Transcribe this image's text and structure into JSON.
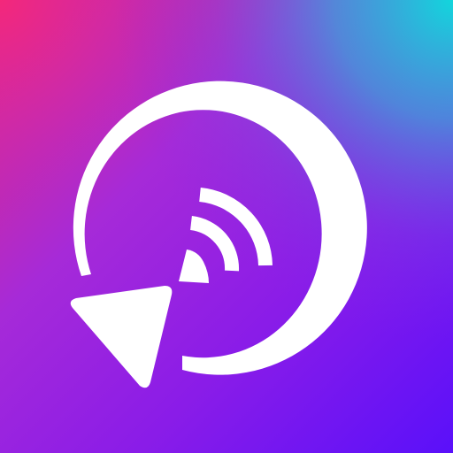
{
  "icon": {
    "name": "cast-replay-app-icon",
    "glyph": "white"
  },
  "colors": {
    "top_left": "#f0287a",
    "top_right": "#14d2dc",
    "center": "#9a2ee0",
    "bottom": "#6a14f0",
    "bottom_right": "#5a10ff",
    "glyph": "#ffffff"
  }
}
